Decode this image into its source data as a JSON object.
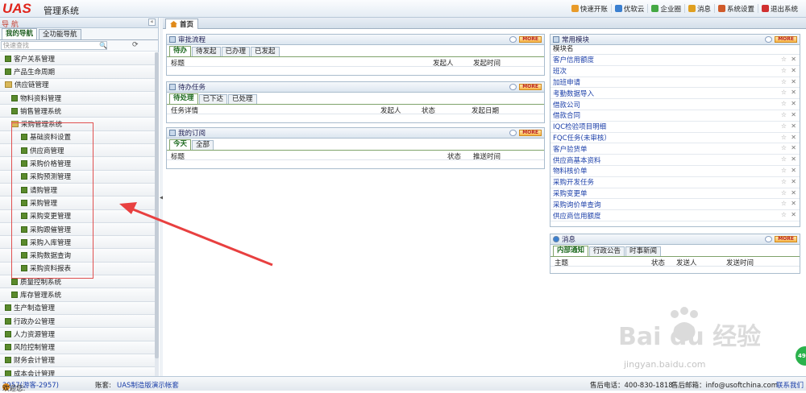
{
  "app": {
    "logo": "UAS",
    "title": "管理系统"
  },
  "topnav": [
    {
      "label": "快速开账",
      "color": "#e89b2a"
    },
    {
      "label": "优软云",
      "color": "#3a7fd0"
    },
    {
      "label": "企业圈",
      "color": "#44a844"
    },
    {
      "label": "消息",
      "color": "#e0a020"
    },
    {
      "label": "系统设置",
      "color": "#d05a2a"
    },
    {
      "label": "退出系统",
      "color": "#d03030"
    }
  ],
  "sidebar": {
    "title": "导 航",
    "collapse": "«",
    "tabs": [
      "我的导航",
      "全功能导航"
    ],
    "search_placeholder": "快速查找",
    "search_icon": "🔍",
    "refresh_icon": "⟳",
    "tree": [
      {
        "label": "客户关系管理",
        "level": 0,
        "icon": "sq"
      },
      {
        "label": "产品生命周期",
        "level": 0,
        "icon": "sq"
      },
      {
        "label": "供应链管理",
        "level": 0,
        "icon": "fold"
      },
      {
        "label": "物料资料管理",
        "level": 1,
        "icon": "sq"
      },
      {
        "label": "销售管理系统",
        "level": 1,
        "icon": "sq"
      },
      {
        "label": "采购管理系统",
        "level": 1,
        "icon": "fold",
        "highlight": true
      },
      {
        "label": "基础资料设置",
        "level": 2,
        "icon": "sq"
      },
      {
        "label": "供应商管理",
        "level": 2,
        "icon": "sq"
      },
      {
        "label": "采购价格管理",
        "level": 2,
        "icon": "sq"
      },
      {
        "label": "采购预测管理",
        "level": 2,
        "icon": "sq"
      },
      {
        "label": "请购管理",
        "level": 2,
        "icon": "sq"
      },
      {
        "label": "采购管理",
        "level": 2,
        "icon": "sq"
      },
      {
        "label": "采购变更管理",
        "level": 2,
        "icon": "sq"
      },
      {
        "label": "采购跟催管理",
        "level": 2,
        "icon": "sq"
      },
      {
        "label": "采购入库管理",
        "level": 2,
        "icon": "sq"
      },
      {
        "label": "采购数据查询",
        "level": 2,
        "icon": "sq"
      },
      {
        "label": "采购资料报表",
        "level": 2,
        "icon": "sq"
      },
      {
        "label": "质量控制系统",
        "level": 1,
        "icon": "sq"
      },
      {
        "label": "库存管理系统",
        "level": 1,
        "icon": "sq"
      },
      {
        "label": "生产制造管理",
        "level": 0,
        "icon": "sq"
      },
      {
        "label": "行政办公管理",
        "level": 0,
        "icon": "sq"
      },
      {
        "label": "人力资源管理",
        "level": 0,
        "icon": "sq"
      },
      {
        "label": "风险控制管理",
        "level": 0,
        "icon": "sq"
      },
      {
        "label": "财务会计管理",
        "level": 0,
        "icon": "sq"
      },
      {
        "label": "成本会计管理",
        "level": 0,
        "icon": "sq"
      }
    ]
  },
  "main": {
    "home_tab": "首页",
    "more_label": "MORE",
    "approval": {
      "title": "审批流程",
      "tabs": [
        "待办",
        "待发起",
        "已办理",
        "已发起"
      ],
      "cols": [
        "标题",
        "发起人",
        "发起时间"
      ]
    },
    "tasks": {
      "title": "待办任务",
      "tabs": [
        "待处理",
        "已下达",
        "已处理"
      ],
      "cols": [
        "任务详情",
        "发起人",
        "状态",
        "发起日期"
      ]
    },
    "subs": {
      "title": "我的订阅",
      "tabs": [
        "今天",
        "全部"
      ],
      "cols": [
        "标题",
        "状态",
        "推送时间"
      ]
    },
    "modules": {
      "title": "常用模块",
      "col": "模块名",
      "items": [
        "客户信用额度",
        "班次",
        "加班申请",
        "考勤数据导入",
        "借款公司",
        "借款合同",
        "IQC检验项目明细",
        "FQC任务(未审核）",
        "客户验货单",
        "供应商基本资料",
        "物料核价单",
        "采购开发任务",
        "采购变更单",
        "采购询价单查询",
        "供应商信用额度"
      ],
      "star": "☆",
      "remove": "✕"
    },
    "messages": {
      "title": "消息",
      "tabs": [
        "内部通知",
        "行政公告",
        "时事新闻"
      ],
      "cols": [
        "主题",
        "状态",
        "发送人",
        "发送时间"
      ]
    }
  },
  "status": {
    "welcome": "欢迎您:",
    "user": "2957(游客-2957)",
    "account_label": "账套:",
    "account": "UAS制造版演示帐套",
    "hotline": "售后电话：400-830-1818",
    "email": "售后邮箱：info@usoftchina.com",
    "contact": "联系我们"
  },
  "overlay": {
    "badge": "49",
    "watermark": "Bai du 经验",
    "watermark_url": "jingyan.baidu.com"
  }
}
